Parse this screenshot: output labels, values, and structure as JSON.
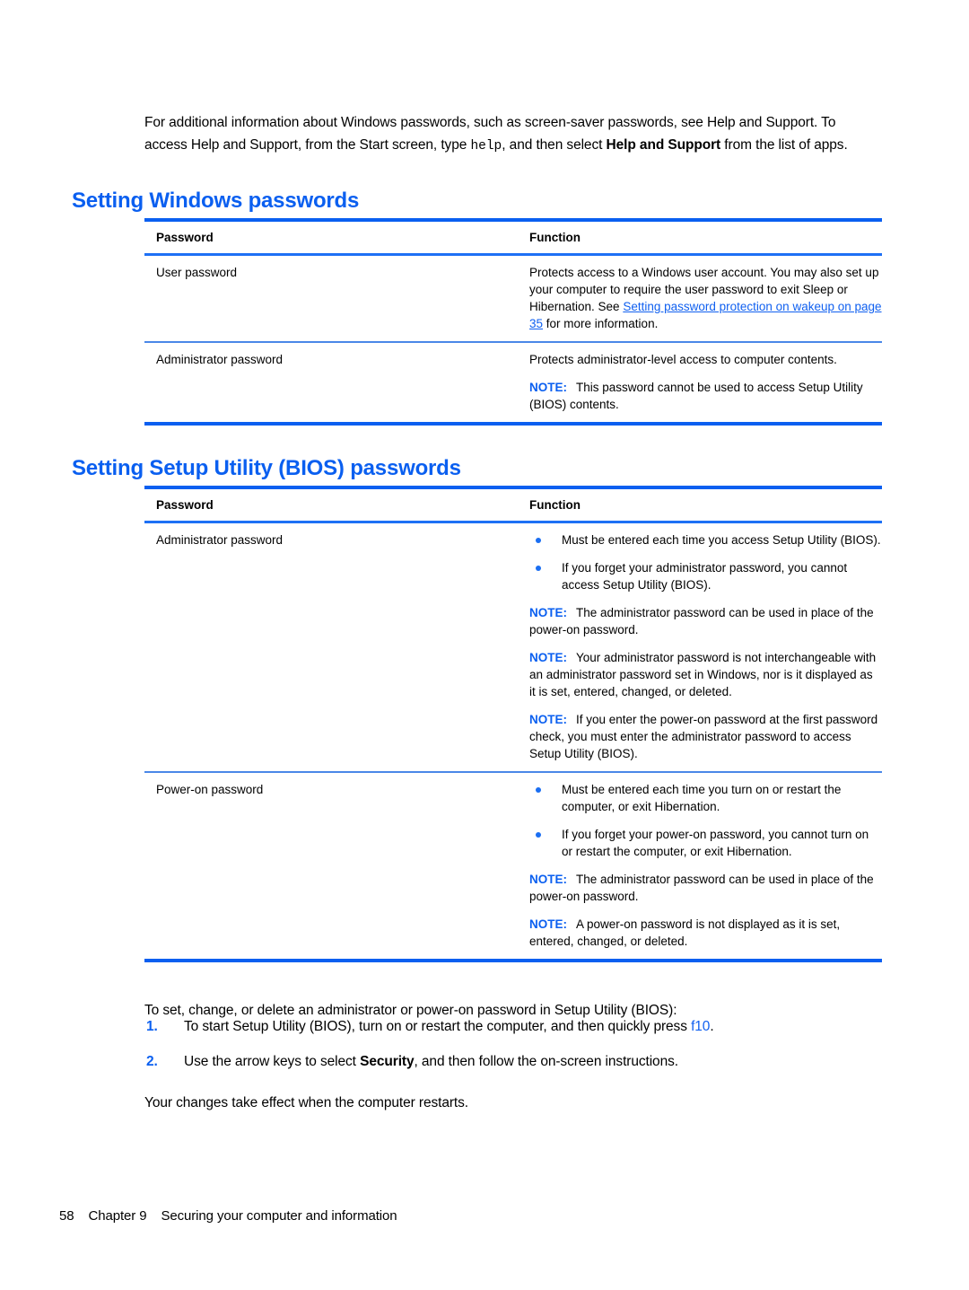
{
  "document": {
    "intro": {
      "part1": "For additional information about Windows passwords, such as screen-saver passwords, see Help and Support. To access Help and Support, from the Start screen, type ",
      "code": "help",
      "part2": ", and then select ",
      "bold": "Help and Support",
      "part3": " from the list of apps."
    },
    "sections": [
      {
        "heading": "Setting Windows passwords",
        "table": {
          "headers": [
            "Password",
            "Function"
          ],
          "rows": [
            {
              "password": "User password",
              "function_paras": [
                {
                  "text_before": "Protects access to a Windows user account. You may also set up your computer to require the user password to exit Sleep or Hibernation. See ",
                  "link": "Setting password protection on wakeup on page 35",
                  "text_after": " for more information."
                }
              ]
            },
            {
              "password": "Administrator password",
              "function_paras": [
                {
                  "text": "Protects administrator-level access to computer contents."
                },
                {
                  "note": "NOTE:",
                  "text": "This password cannot be used to access Setup Utility (BIOS) contents."
                }
              ]
            }
          ]
        }
      },
      {
        "heading": "Setting Setup Utility (BIOS) passwords",
        "table": {
          "headers": [
            "Password",
            "Function"
          ],
          "rows": [
            {
              "password": "Administrator password",
              "bullets": [
                "Must be entered each time you access Setup Utility (BIOS).",
                "If you forget your administrator password, you cannot access Setup Utility (BIOS)."
              ],
              "function_paras": [
                {
                  "note": "NOTE:",
                  "text": "The administrator password can be used in place of the power-on password."
                },
                {
                  "note": "NOTE:",
                  "text": "Your administrator password is not interchangeable with an administrator password set in Windows, nor is it displayed as it is set, entered, changed, or deleted."
                },
                {
                  "note": "NOTE:",
                  "text": "If you enter the power-on password at the first password check, you must enter the administrator password to access Setup Utility (BIOS)."
                }
              ]
            },
            {
              "password": "Power-on password",
              "bullets": [
                "Must be entered each time you turn on or restart the computer, or exit Hibernation.",
                "If you forget your power-on password, you cannot turn on or restart the computer, or exit Hibernation."
              ],
              "function_paras": [
                {
                  "note": "NOTE:",
                  "text": "The administrator password can be used in place of the power-on password."
                },
                {
                  "note": "NOTE:",
                  "text": "A power-on password is not displayed as it is set, entered, changed, or deleted."
                }
              ]
            }
          ]
        }
      }
    ],
    "procedure": {
      "lead": "To set, change, or delete an administrator or power-on password in Setup Utility (BIOS):",
      "steps": [
        {
          "num": "1.",
          "text_before": "To start Setup Utility (BIOS), turn on or restart the computer, and then quickly press ",
          "key": "f10",
          "text_after": "."
        },
        {
          "num": "2.",
          "text_before": "Use the arrow keys to select ",
          "bold": "Security",
          "text_after": ", and then follow the on-screen instructions."
        }
      ],
      "closing": "Your changes take effect when the computer restarts."
    },
    "footer": {
      "page_number": "58",
      "chapter": "Chapter 9",
      "title": "Securing your computer and information"
    },
    "colors": {
      "heading_blue": "#0a5ff0",
      "rule_blue": "#0a5ff0",
      "link_blue": "#1060f0",
      "bullet_blue": "#1a6ef2"
    }
  }
}
